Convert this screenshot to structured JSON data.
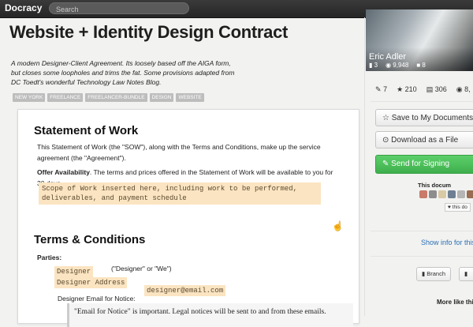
{
  "topbar": {
    "brand": "Docracy",
    "search_placeholder": "Search"
  },
  "document": {
    "title": "Website + Identity Design Contract",
    "description": "A modern Designer-Client Agreement. Its loosely based off the AIGA form, but closes some loopholes and trims the fat. Some provisions adapted from DC Toedt's wonderful Technology Law Notes Blog.",
    "tags": [
      "NEW YORK",
      "FREELANCE",
      "FREELANCER-BUNDLE",
      "DESIGN",
      "WEBSITE"
    ]
  },
  "contract": {
    "sow_heading": "Statement of Work",
    "sow_text": "This Statement of Work (the \"SOW\"), along with the Terms and Conditions, make up the service agreement (the \"Agreement\").",
    "offer_label": "Offer Availability",
    "offer_text": ". The terms and prices offered in the Statement of Work will be available to you for 30 days.",
    "scope_placeholder": "Scope of Work inserted here, including work to be performed, deliverables, and payment schedule",
    "terms_heading": "Terms & Conditions",
    "parties_label": "Parties:",
    "designer": "Designer",
    "designer_address": "Designer Address",
    "designer_alias": "(\"Designer\" or \"We\")",
    "email_label": "Designer Email for Notice:",
    "email_value": "designer@email.com",
    "notice_text": "\"Email for Notice\" is important. Legal notices will be sent to and from these emails."
  },
  "sidebar": {
    "profile": {
      "name": "Eric Adler",
      "docs": "3",
      "views": "9,948",
      "signs": "8"
    },
    "stats": {
      "forks": "7",
      "stars": "210",
      "views": "306",
      "other": "8,"
    },
    "buttons": {
      "save": "Save to My Documents",
      "download": "Download as a File",
      "sign": "Send for Signing"
    },
    "signers_label": "This docum",
    "like_label": "this do",
    "show_info": "Show info for this",
    "branch": "Branch",
    "more_like": "More like this"
  },
  "colors": {
    "topbar": "#2e2e2e",
    "highlight": "#fbe4c1",
    "sign_green": "#44b552",
    "link_blue": "#2a6fb5"
  }
}
